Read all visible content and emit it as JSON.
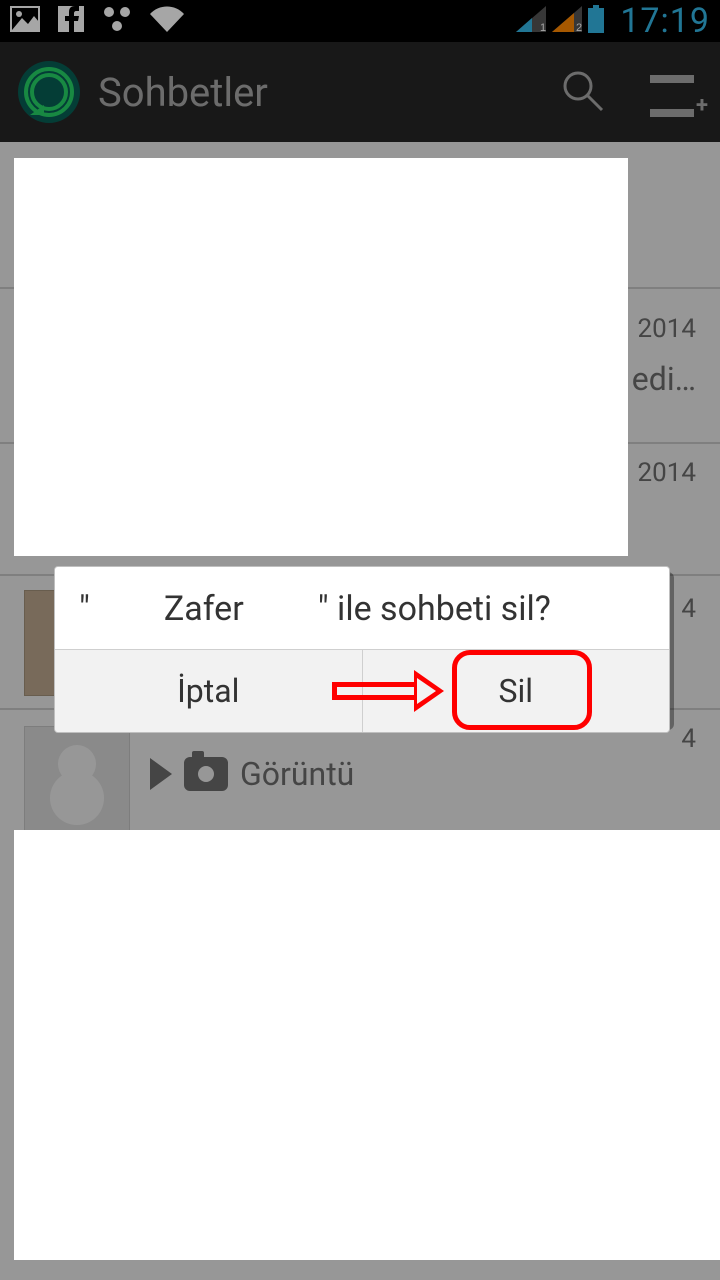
{
  "status": {
    "clock": "17:19"
  },
  "actionbar": {
    "title": "Sohbetler"
  },
  "chats": {
    "date1": "2014",
    "snippet1": "edi…",
    "date2": "2014",
    "date3": "4",
    "date4": "4",
    "media_label": "Görüntü"
  },
  "dialog": {
    "quote_open": "\"",
    "name_mid": "Zafer",
    "quote_close": "\"",
    "rest": " ile sohbeti sil?",
    "cancel": "İptal",
    "delete": "Sil"
  }
}
